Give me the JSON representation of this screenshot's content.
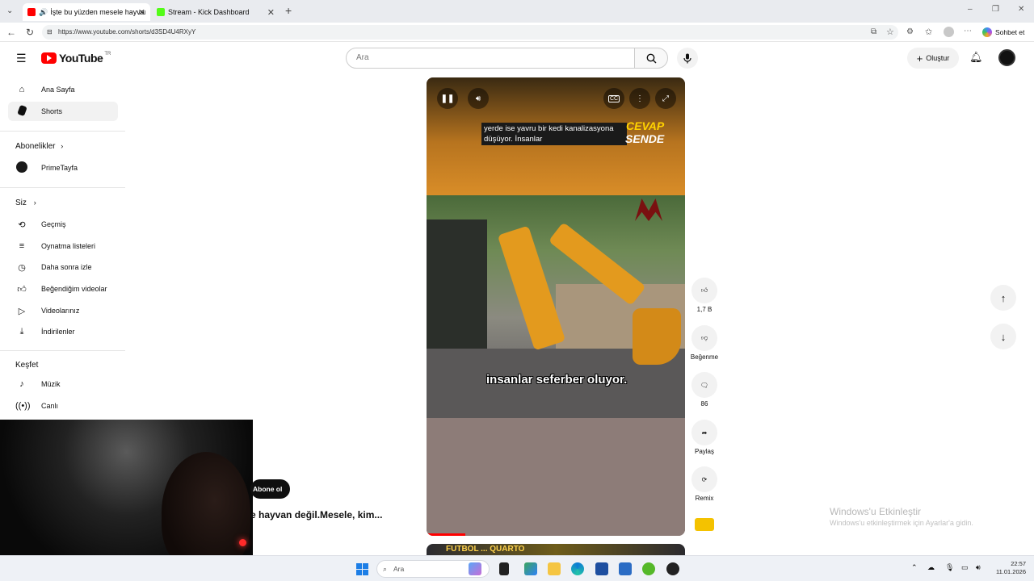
{
  "browser": {
    "tabs": [
      {
        "label": "İşte bu yüzden mesele hayvan",
        "active": true
      },
      {
        "label": "Stream - Kick Dashboard",
        "active": false
      }
    ],
    "url": "https://www.youtube.com/shorts/d3SD4U4RXyY",
    "chat_label": "Sohbet et"
  },
  "header": {
    "logo_text": "YouTube",
    "logo_region": "TR",
    "search_placeholder": "Ara",
    "create_label": "Oluştur"
  },
  "sidebar": {
    "items_top": [
      {
        "label": "Ana Sayfa",
        "icon": "home-icon"
      },
      {
        "label": "Shorts",
        "icon": "shorts-icon"
      }
    ],
    "subscriptions_heading": "Abonelikler",
    "subscriptions": [
      {
        "label": "PrimeTayfa"
      }
    ],
    "you_heading": "Siz",
    "you_items": [
      {
        "label": "Geçmiş",
        "icon": "history-icon"
      },
      {
        "label": "Oynatma listeleri",
        "icon": "playlist-icon"
      },
      {
        "label": "Daha sonra izle",
        "icon": "clock-icon"
      },
      {
        "label": "Beğendiğim videolar",
        "icon": "thumbs-up-icon"
      },
      {
        "label": "Videolarınız",
        "icon": "play-square-icon"
      },
      {
        "label": "İndirilenler",
        "icon": "download-icon"
      }
    ],
    "explore_heading": "Keşfet",
    "explore_items": [
      {
        "label": "Müzik",
        "icon": "music-icon"
      },
      {
        "label": "Canlı",
        "icon": "live-icon"
      }
    ]
  },
  "video": {
    "subtitle_top": "yerde ise yavru bir kedi kanalizasyona düşüyor. İnsanlar",
    "subtitle_bottom": "insanlar seferber oluyor.",
    "brand_top": "CEVAP",
    "brand_bottom": "SENDE",
    "progress_fraction": 0.15,
    "next_video_text": "FUTBOL ... QUARTO"
  },
  "actions": {
    "like_count": "1,7 B",
    "dislike_label": "Beğenme",
    "comment_count": "86",
    "share_label": "Paylaş",
    "remix_label": "Remix"
  },
  "channel": {
    "subscribe_label": "Abone ol",
    "title": "e hayvan değil.Mesele, kim..."
  },
  "watermark": {
    "line1": "Windows'u Etkinleştir",
    "line2": "Windows'u etkinleştirmek için Ayarlar'a gidin."
  },
  "taskbar": {
    "search_placeholder": "Ara",
    "time": "22:57",
    "date": "11.01.2026"
  }
}
